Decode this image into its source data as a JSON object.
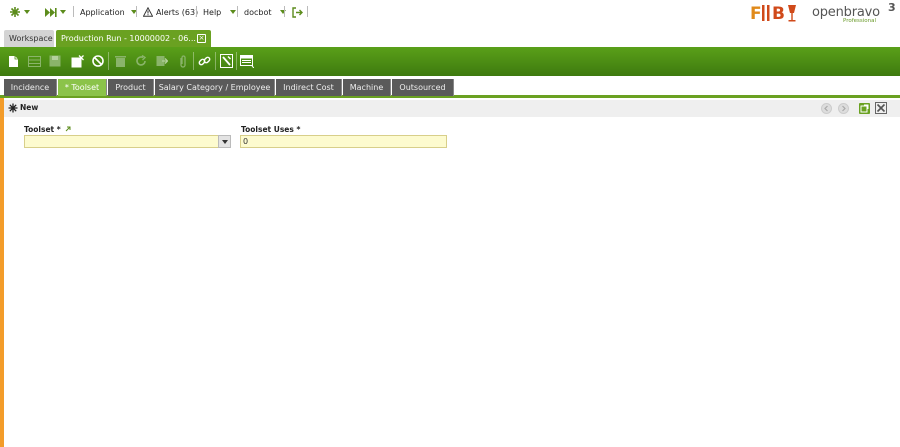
{
  "nav": {
    "application_label": "Application",
    "alerts_label": "Alerts (63)",
    "help_label": "Help",
    "user_label": "docbot"
  },
  "logos": {
    "brand_text": "F I B",
    "product_text": "openbravo",
    "product_version": "3",
    "product_edition": "Professional"
  },
  "window_tabs": {
    "workspace_label": "Workspace",
    "active_label": "Production Run - 10000002 - 06..."
  },
  "child_tabs": [
    {
      "label": "Incidence"
    },
    {
      "label": "* Toolset"
    },
    {
      "label": "Product"
    },
    {
      "label": "Salary Category / Employee"
    },
    {
      "label": "Indirect Cost"
    },
    {
      "label": "Machine"
    },
    {
      "label": "Outsourced"
    }
  ],
  "status": {
    "label": "New"
  },
  "form": {
    "toolset": {
      "label": "Toolset *",
      "value": ""
    },
    "toolset_uses": {
      "label": "Toolset Uses *",
      "value": "0"
    }
  },
  "colors": {
    "accent_green": "#6aa121",
    "toolbar_green": "#4b8c15",
    "selected_tab": "#8bc34a",
    "orange_strip": "#f39c2a",
    "input_bg": "#fdfbcf"
  }
}
